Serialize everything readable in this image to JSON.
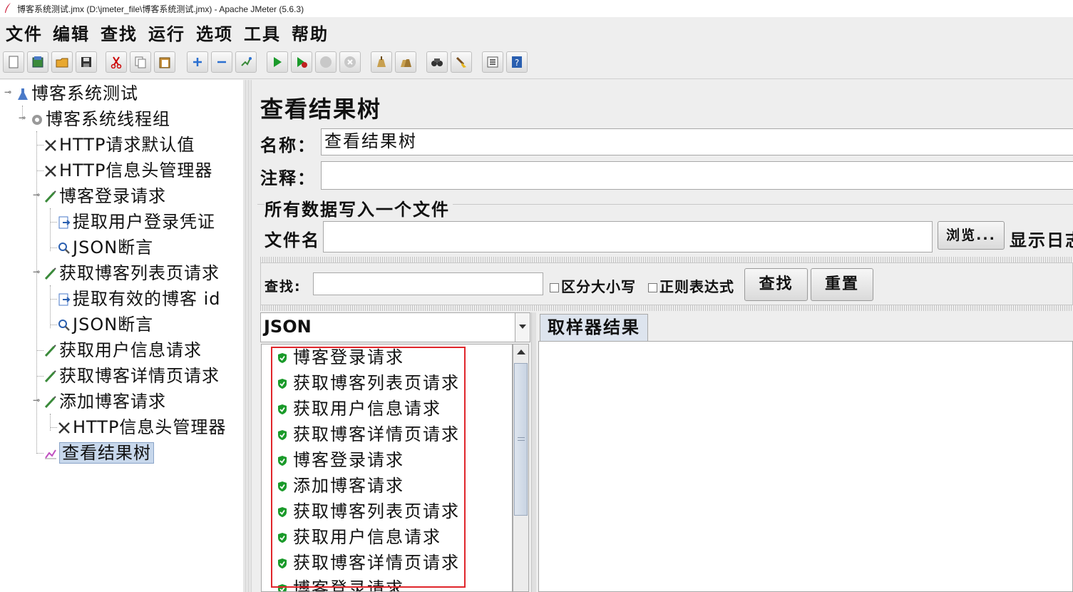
{
  "window": {
    "title": "博客系统测试.jmx (D:\\jmeter_file\\博客系统测试.jmx) - Apache JMeter (5.6.3)"
  },
  "menu": [
    "文件",
    "编辑",
    "查找",
    "运行",
    "选项",
    "工具",
    "帮助"
  ],
  "toolbar_icons": [
    "new-icon",
    "templates-icon",
    "open-icon",
    "save-icon",
    "cut-icon",
    "copy-icon",
    "paste-icon",
    "expand-icon",
    "collapse-icon",
    "toggle-icon",
    "start-icon",
    "start-no-pause-icon",
    "stop-icon",
    "shutdown-icon",
    "clear-icon",
    "clear-all-icon",
    "search-icon",
    "reset-search-icon",
    "function-helper-icon",
    "help-icon"
  ],
  "tree": {
    "items": [
      {
        "label": "博客系统测试",
        "icon": "test-plan-icon"
      },
      {
        "label": "博客系统线程组",
        "icon": "thread-group-icon"
      },
      {
        "label": "HTTP请求默认值",
        "icon": "config-element-icon"
      },
      {
        "label": "HTTP信息头管理器",
        "icon": "config-element-icon"
      },
      {
        "label": "博客登录请求",
        "icon": "sampler-icon"
      },
      {
        "label": "提取用户登录凭证",
        "icon": "post-processor-icon"
      },
      {
        "label": "JSON断言",
        "icon": "assertion-icon"
      },
      {
        "label": "获取博客列表页请求",
        "icon": "sampler-icon"
      },
      {
        "label": "提取有效的博客 id",
        "icon": "post-processor-icon"
      },
      {
        "label": "JSON断言",
        "icon": "assertion-icon"
      },
      {
        "label": "获取用户信息请求",
        "icon": "sampler-icon"
      },
      {
        "label": "获取博客详情页请求",
        "icon": "sampler-icon"
      },
      {
        "label": "添加博客请求",
        "icon": "sampler-icon"
      },
      {
        "label": "HTTP信息头管理器",
        "icon": "config-element-icon"
      },
      {
        "label": "查看结果树",
        "icon": "listener-icon"
      }
    ]
  },
  "panel": {
    "title": "查看结果树",
    "name_label": "名称：",
    "name_value": "查看结果树",
    "comment_label": "注释：",
    "comment_value": "",
    "file_section_title": "所有数据写入一个文件",
    "filename_label": "文件名",
    "filename_value": "",
    "browse_button": "浏览...",
    "log_label": "显示日志"
  },
  "search": {
    "label": "查找:",
    "value": "",
    "case_sensitive": "区分大小写",
    "regex": "正则表达式",
    "find_button": "查找",
    "reset_button": "重置"
  },
  "renderer": {
    "selected": "JSON"
  },
  "results": {
    "status_color": "#1a9a2a",
    "items": [
      "博客登录请求",
      "获取博客列表页请求",
      "获取用户信息请求",
      "获取博客详情页请求",
      "博客登录请求",
      "添加博客请求",
      "获取博客列表页请求",
      "获取用户信息请求",
      "获取博客详情页请求",
      "博客登录请求"
    ]
  },
  "tabs": {
    "sampler_result": "取样器结果"
  },
  "highlight_color": "#e0262b"
}
